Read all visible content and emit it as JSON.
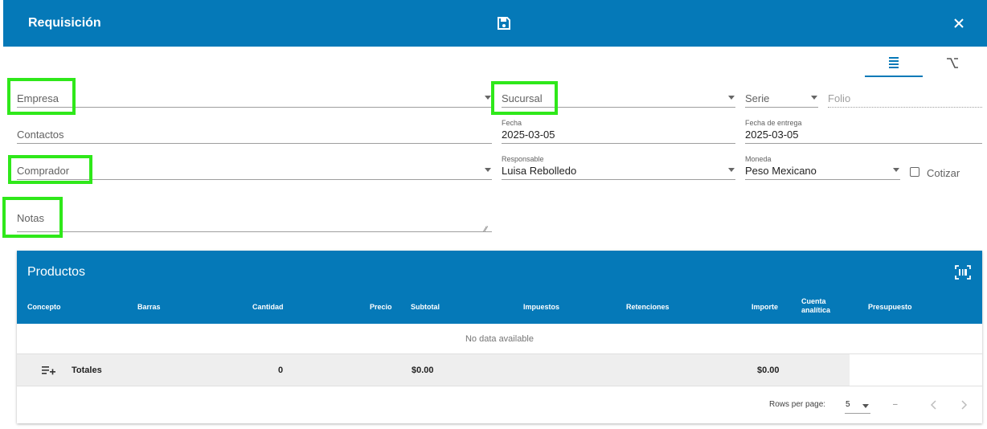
{
  "titlebar": {
    "title": "Requisición"
  },
  "form": {
    "empresa_label": "Empresa",
    "sucursal_label": "Sucursal",
    "serie_label": "Serie",
    "folio_placeholder": "Folio",
    "contactos_label": "Contactos",
    "fecha_label": "Fecha",
    "fecha_value": "2025-03-05",
    "fecha_entrega_label": "Fecha de entrega",
    "fecha_entrega_value": "2025-03-05",
    "comprador_label": "Comprador",
    "responsable_label": "Responsable",
    "responsable_value": "Luisa Rebolledo",
    "moneda_label": "Moneda",
    "moneda_value": "Peso Mexicano",
    "cotizar_label": "Cotizar",
    "notas_label": "Notas"
  },
  "products": {
    "title": "Productos",
    "columns": [
      "Concepto",
      "Barras",
      "Cantidad",
      "Precio",
      "Subtotal",
      "Impuestos",
      "Retenciones",
      "Importe",
      "Cuenta analítica",
      "Presupuesto"
    ],
    "no_data": "No data available",
    "totals": {
      "label": "Totales",
      "cantidad": "0",
      "subtotal": "$0.00",
      "importe": "$0.00"
    },
    "pager": {
      "rows_per_page_label": "Rows per page:",
      "rows_per_page": "5",
      "range": "–"
    }
  },
  "colors": {
    "header_blue": "#0579b8",
    "highlight_green": "#2fe81a",
    "totals_bg": "#eeeeee"
  },
  "icons": [
    "save-icon",
    "close-icon",
    "list-view-icon",
    "branch-option-icon",
    "dropdown-caret-icon",
    "barcode-scan-icon",
    "playlist-add-icon",
    "chevron-left-icon",
    "chevron-right-icon"
  ]
}
